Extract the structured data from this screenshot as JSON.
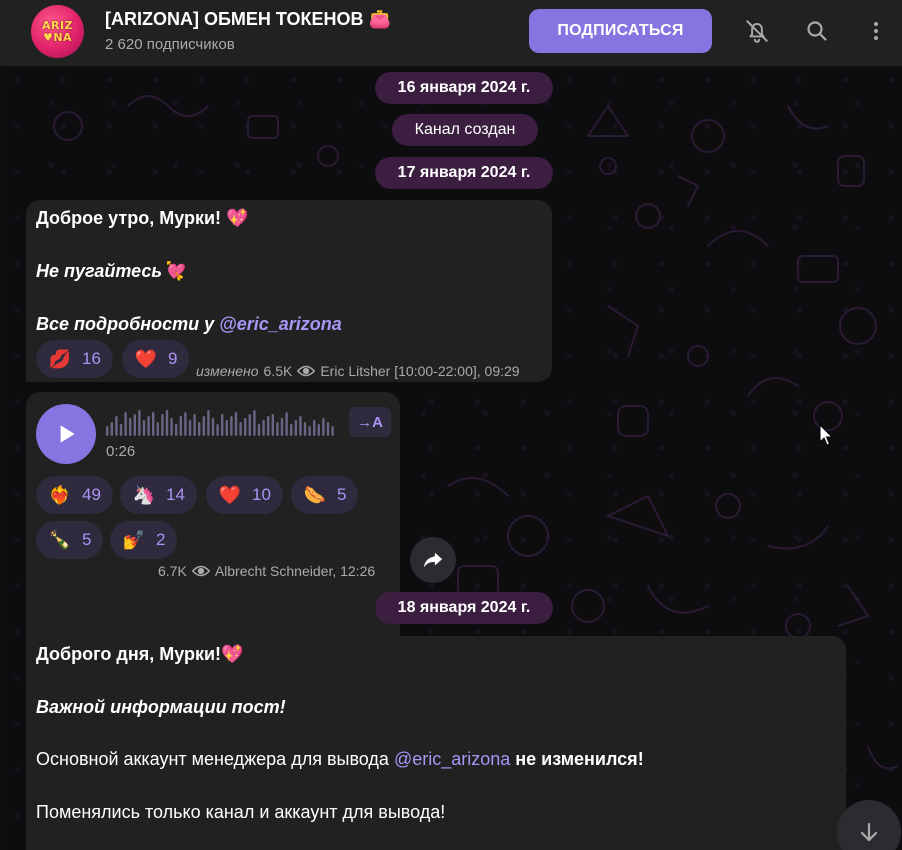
{
  "header": {
    "avatar_line1": "ARIZ",
    "avatar_line2": "♥NA",
    "title": "[ARIZONA] ОБМЕН ТОКЕНОВ 👛",
    "subtitle": "2 620 подписчиков",
    "subscribe_label": "ПОДПИСАТЬСЯ",
    "icons": [
      "mute-bell-icon",
      "search-icon",
      "more-vert-icon"
    ]
  },
  "chat": {
    "date1": "16 января 2024 г.",
    "service": "Канал создан",
    "date2": "17 января 2024 г.",
    "date3": "18 января 2024 г."
  },
  "msg1": {
    "line1": "Доброе утро, Мурки! 💖",
    "line2": "Не пугайтесь💘",
    "line3_prefix": "Все подробности у ",
    "line3_link": "@eric_arizona",
    "reactions": [
      {
        "emoji": "💋",
        "count": "16"
      },
      {
        "emoji": "❤️",
        "count": "9"
      }
    ],
    "edited": "изменено",
    "views": "6.5K",
    "author_time": "Eric Litsher [10:00-22:00], 09:29"
  },
  "msg2": {
    "duration": "0:26",
    "transcribe_label": "→A",
    "reactions": [
      {
        "emoji": "❤️‍🔥",
        "count": "49"
      },
      {
        "emoji": "🦄",
        "count": "14"
      },
      {
        "emoji": "❤️",
        "count": "10"
      },
      {
        "emoji": "🌭",
        "count": "5"
      },
      {
        "emoji": "🍾",
        "count": "5"
      },
      {
        "emoji": "💅",
        "count": "2"
      }
    ],
    "views": "6.7K",
    "author_time": "Albrecht Schneider, 12:26"
  },
  "msg3": {
    "line1": "Доброго дня, Мурки!💖",
    "line2": "Важной информации пост!",
    "line3_prefix": "Основной аккаунт менеджера для вывода ",
    "line3_link": "@eric_arizona",
    "line3_suffix": " не изменился!",
    "line4": "Поменялись только канал и аккаунт для вывода!"
  },
  "colors": {
    "accent": "#8774e1",
    "header_bg": "#212121",
    "bubble_bg": "#212121",
    "date_pill_bg": "#3c1f40",
    "reaction_bg": "#2f2a3d",
    "link": "#a895f5"
  }
}
